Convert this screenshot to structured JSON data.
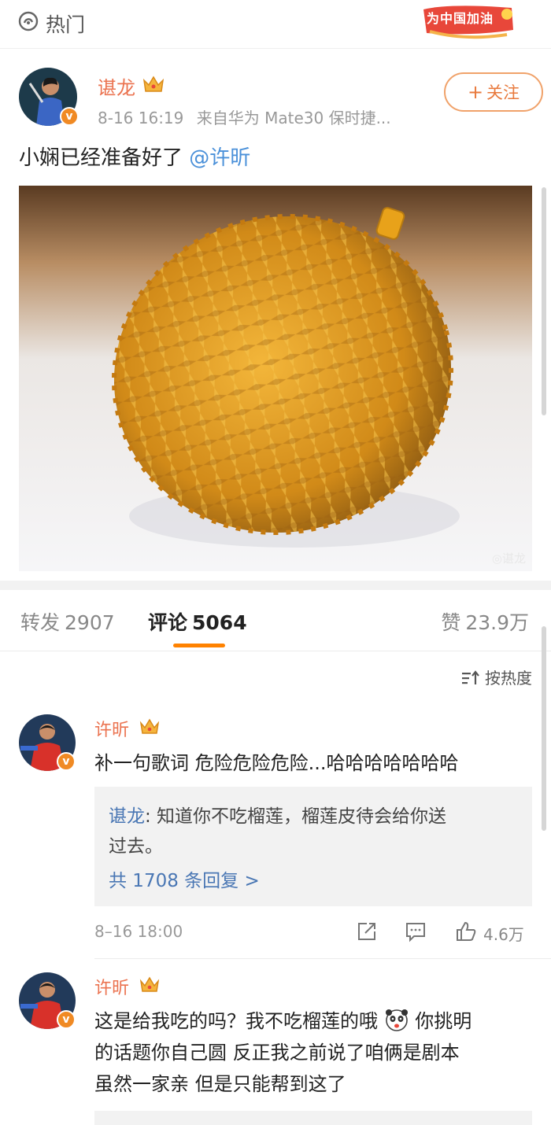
{
  "topbar": {
    "hot_label": "热门",
    "promo_text": "为中国加油"
  },
  "post": {
    "author": "谌龙",
    "time": "8-16 16:19",
    "source": "来自华为 Mate30 保时捷...",
    "follow_label": "关注",
    "text": "小娴已经准备好了",
    "mention": "@许昕",
    "watermark": "◎谌龙"
  },
  "tabs": {
    "repost_label": "转发",
    "repost_count": "2907",
    "comment_label": "评论",
    "comment_count": "5064",
    "like_label": "赞",
    "like_count": "23.9万"
  },
  "sort_label": "按热度",
  "comments": [
    {
      "name": "许昕",
      "text": "补一句歌词 危险危险危险...哈哈哈哈哈哈哈",
      "reply": {
        "author": "谌龙",
        "text_line1": ": 知道你不吃榴莲，榴莲皮待会给你送",
        "text_line2": "过去。",
        "more": "共 1708 条回复 >"
      },
      "time": "8–16 18:00",
      "likes": "4.6万"
    },
    {
      "name": "许昕",
      "text_line1": "这是给我吃的吗？我不吃榴莲的哦",
      "text_line1_tail": "你挑明",
      "text_line2": "的话题你自己圆 反正我之前说了咱俩是剧本",
      "text_line3": "虽然一家亲 但是只能帮到这了"
    }
  ],
  "colors": {
    "brand_orange": "#ff8200",
    "name_orange": "#eb7350",
    "link_blue": "#4a77b4"
  }
}
